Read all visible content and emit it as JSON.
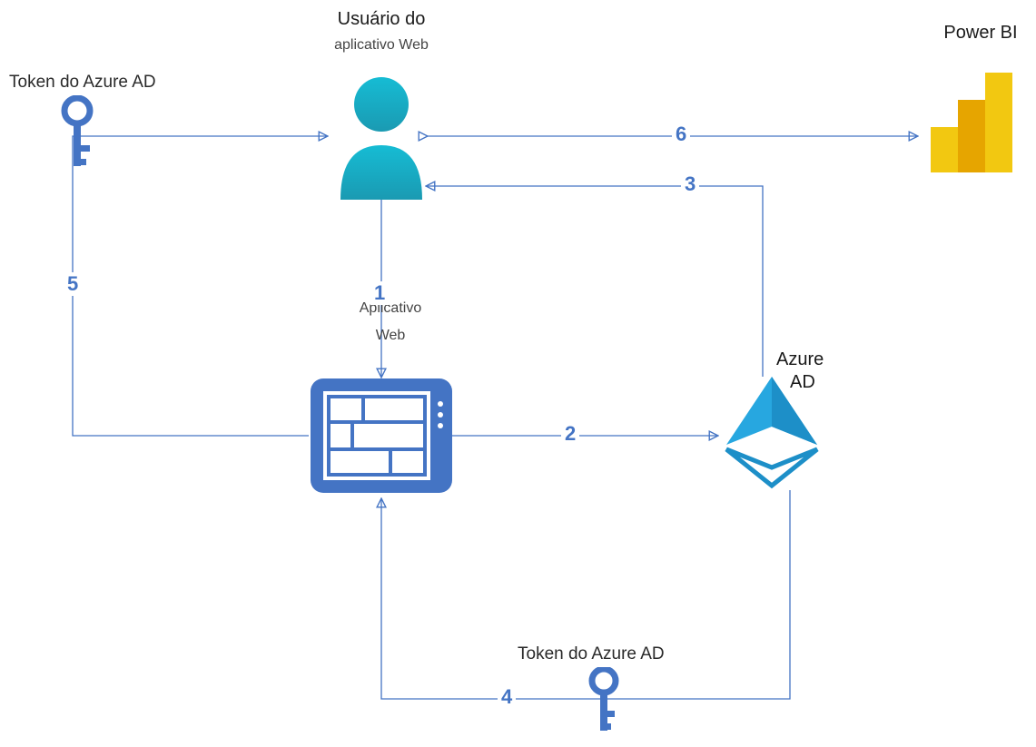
{
  "nodes": {
    "user": {
      "title": "Usuário do",
      "subtitle": "aplicativo Web"
    },
    "powerbi": {
      "title": "Power BI"
    },
    "token1": {
      "title": "Token do Azure AD"
    },
    "webapp": {
      "title": "Aplicativo",
      "subtitle": "Web"
    },
    "azuread": {
      "title": "Azure",
      "subtitle": "AD"
    },
    "token2": {
      "title": "Token do Azure AD"
    }
  },
  "edges": {
    "e1": "1",
    "e2": "2",
    "e3": "3",
    "e4": "4",
    "e5": "5",
    "e6": "6"
  },
  "chart_data": {
    "type": "flow-diagram",
    "nodes": [
      {
        "id": "user",
        "label": "Usuário do aplicativo Web"
      },
      {
        "id": "powerbi",
        "label": "Power BI"
      },
      {
        "id": "token1",
        "label": "Token do Azure AD"
      },
      {
        "id": "webapp",
        "label": "Aplicativo Web"
      },
      {
        "id": "azuread",
        "label": "Azure AD"
      },
      {
        "id": "token2",
        "label": "Token do Azure AD"
      }
    ],
    "edges": [
      {
        "id": 1,
        "from": "user",
        "to": "webapp",
        "direction": "one-way"
      },
      {
        "id": 2,
        "from": "webapp",
        "to": "azuread",
        "direction": "one-way"
      },
      {
        "id": 3,
        "from": "azuread",
        "to": "user",
        "direction": "one-way"
      },
      {
        "id": 4,
        "from": "azuread",
        "to": "webapp",
        "via": "token2",
        "direction": "one-way"
      },
      {
        "id": 5,
        "from": "webapp",
        "to": "user",
        "via": "token1",
        "direction": "one-way"
      },
      {
        "id": 6,
        "from": "user",
        "to": "powerbi",
        "direction": "two-way"
      }
    ]
  }
}
